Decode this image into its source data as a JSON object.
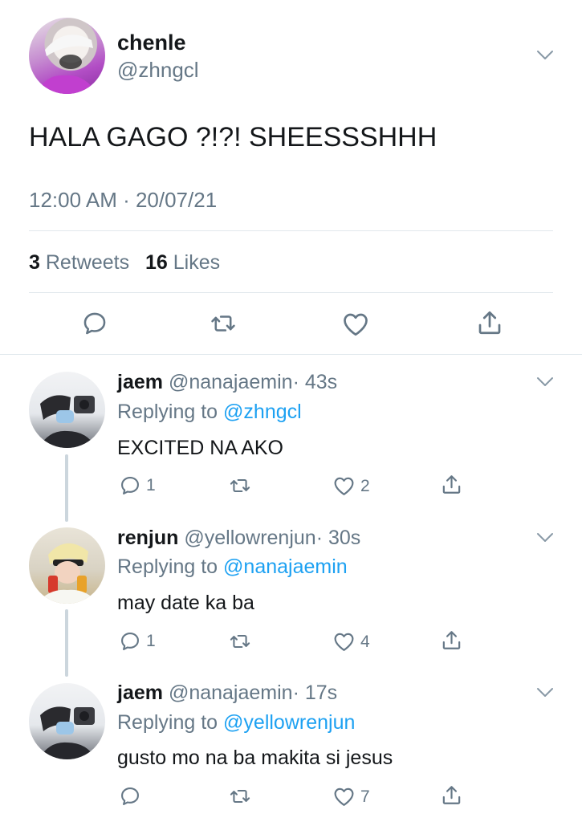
{
  "tweet": {
    "name": "chenle",
    "handle": "@zhngcl",
    "text": "HALA GAGO ?!?! SHEESSSHHH",
    "timestamp": "12:00 AM · 20/07/21",
    "retweet_count": "3",
    "retweet_label": "Retweets",
    "like_count": "16",
    "like_label": "Likes"
  },
  "replies": [
    {
      "name": "jaem",
      "handle": "@nanajaemin",
      "time": "· 43s",
      "replying_prefix": "Replying to",
      "replying_to": "@zhngcl",
      "text": "EXCITED NA AKO",
      "reply_count": "1",
      "like_count": "2"
    },
    {
      "name": "renjun",
      "handle": "@yellowrenjun",
      "time": "· 30s",
      "replying_prefix": "Replying to",
      "replying_to": "@nanajaemin",
      "text": "may date ka ba",
      "reply_count": "1",
      "like_count": "4"
    },
    {
      "name": "jaem",
      "handle": "@nanajaemin",
      "time": "· 17s",
      "replying_prefix": "Replying to",
      "replying_to": "@yellowrenjun",
      "text": "gusto mo na ba makita si jesus",
      "reply_count": "",
      "like_count": "7"
    }
  ],
  "icons": {
    "reply": "comment-icon",
    "retweet": "retweet-icon",
    "like": "heart-icon",
    "share": "share-icon",
    "more": "chevron-down-icon"
  },
  "colors": {
    "text": "#14171a",
    "muted": "#657786",
    "link": "#1da1f2",
    "divider": "#e1e8ed"
  }
}
